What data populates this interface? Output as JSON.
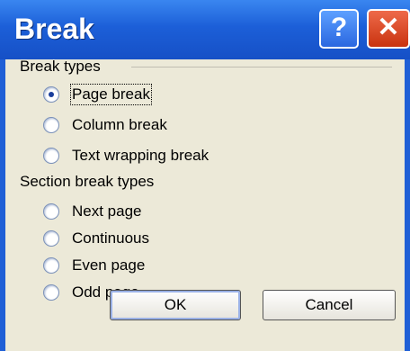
{
  "dialog": {
    "title": "Break",
    "help_glyph": "?",
    "close_glyph": "✕"
  },
  "break_types": {
    "label": "Break types",
    "options": [
      {
        "label": "Page break",
        "checked": true
      },
      {
        "label": "Column break",
        "checked": false
      },
      {
        "label": "Text wrapping break",
        "checked": false
      }
    ]
  },
  "section_break_types": {
    "label": "Section break types",
    "options": [
      {
        "label": "Next page",
        "checked": false
      },
      {
        "label": "Continuous",
        "checked": false
      },
      {
        "label": "Even page",
        "checked": false
      },
      {
        "label": "Odd page",
        "checked": false
      }
    ]
  },
  "buttons": {
    "ok": "OK",
    "cancel": "Cancel"
  }
}
